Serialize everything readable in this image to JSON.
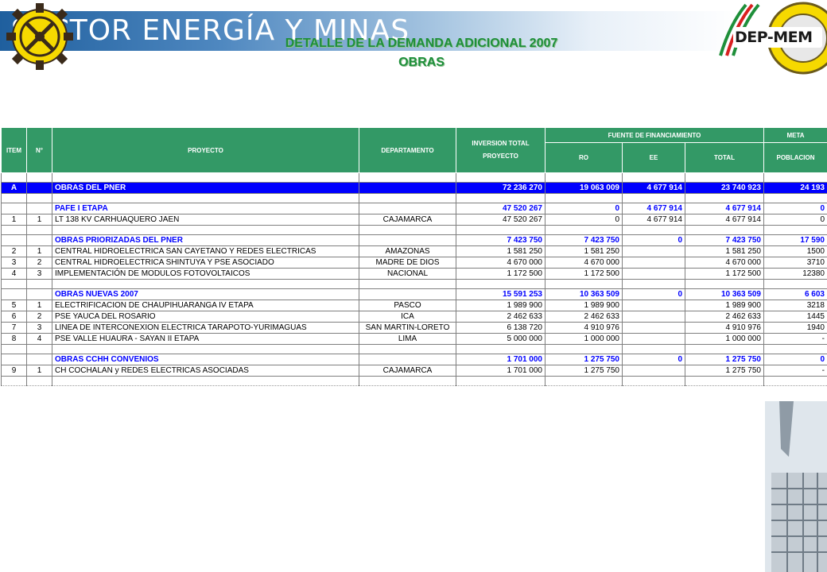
{
  "header": {
    "banner_title": "SECTOR ENERGÍA Y MINAS",
    "title_line1": "DETALLE DE LA DEMANDA ADICIONAL 2007",
    "title_line2": "OBRAS",
    "logo_text": "DEP-MEM"
  },
  "colors": {
    "header_green": "#339966",
    "total_blue": "#0000ff",
    "section_blue": "#0000ff",
    "title_green": "#1e8f3a"
  },
  "table": {
    "headers": {
      "item": "ITEM",
      "no": "N°",
      "proyecto": "PROYECTO",
      "departamento": "DEPARTAMENTO",
      "inversion_1": "INVERSION TOTAL",
      "inversion_2": "PROYECTO",
      "fuente": "FUENTE DE FINANCIAMIENTO",
      "meta": "META",
      "ro": "RO",
      "ee": "EE",
      "total": "TOTAL",
      "poblacion": "POBLACION"
    },
    "grand_total": {
      "item": "A",
      "proyecto": "OBRAS DEL PNER",
      "inversion": "72 236 270",
      "ro": "19 063 009",
      "ee": "4 677 914",
      "total": "23 740 923",
      "poblacion": "24 193"
    },
    "sections": [
      {
        "title": {
          "proyecto": "PAFE I ETAPA",
          "inversion": "47 520 267",
          "ro": "0",
          "ee": "4 677 914",
          "total": "4 677 914",
          "poblacion": "0"
        },
        "rows": [
          {
            "item": "1",
            "no": "1",
            "proyecto": "LT 138 KV CARHUAQUERO JAEN",
            "departamento": "CAJAMARCA",
            "inversion": "47 520 267",
            "ro": "0",
            "ee": "4 677 914",
            "total": "4 677 914",
            "poblacion": "0"
          }
        ]
      },
      {
        "title": {
          "proyecto": "OBRAS PRIORIZADAS DEL PNER",
          "inversion": "7 423 750",
          "ro": "7 423 750",
          "ee": "0",
          "total": "7 423 750",
          "poblacion": "17 590"
        },
        "rows": [
          {
            "item": "2",
            "no": "1",
            "proyecto": "CENTRAL HIDROELECTRICA SAN CAYETANO Y REDES ELECTRICAS",
            "departamento": "AMAZONAS",
            "inversion": "1 581 250",
            "ro": "1 581 250",
            "ee": "",
            "total": "1 581 250",
            "poblacion": "1500"
          },
          {
            "item": "3",
            "no": "2",
            "proyecto": "CENTRAL HIDROELECTRICA SHINTUYA Y PSE ASOCIADO",
            "departamento": "MADRE DE DIOS",
            "inversion": "4 670 000",
            "ro": "4 670 000",
            "ee": "",
            "total": "4 670 000",
            "poblacion": "3710"
          },
          {
            "item": "4",
            "no": "3",
            "proyecto": "IMPLEMENTACIÓN DE MODULOS FOTOVOLTAICOS",
            "departamento": "NACIONAL",
            "inversion": "1 172 500",
            "ro": "1 172 500",
            "ee": "",
            "total": "1 172 500",
            "poblacion": "12380"
          }
        ]
      },
      {
        "title": {
          "proyecto": "OBRAS NUEVAS 2007",
          "inversion": "15 591 253",
          "ro": "10 363 509",
          "ee": "0",
          "total": "10 363 509",
          "poblacion": "6 603"
        },
        "rows": [
          {
            "item": "5",
            "no": "1",
            "proyecto": "ELECTRIFICACION DE CHAUPIHUARANGA IV ETAPA",
            "departamento": "PASCO",
            "inversion": "1 989 900",
            "ro": "1 989 900",
            "ee": "",
            "total": "1 989 900",
            "poblacion": "3218"
          },
          {
            "item": "6",
            "no": "2",
            "proyecto": "PSE YAUCA DEL ROSARIO",
            "departamento": "ICA",
            "inversion": "2 462 633",
            "ro": "2 462 633",
            "ee": "",
            "total": "2 462 633",
            "poblacion": "1445"
          },
          {
            "item": "7",
            "no": "3",
            "proyecto": "LINEA DE INTERCONEXION ELECTRICA TARAPOTO-YURIMAGUAS",
            "departamento": "SAN MARTIN-LORETO",
            "inversion": "6 138 720",
            "ro": "4 910 976",
            "ee": "",
            "total": "4 910 976",
            "poblacion": "1940"
          },
          {
            "item": "8",
            "no": "4",
            "proyecto": "PSE VALLE HUAURA - SAYAN II ETAPA",
            "departamento": "LIMA",
            "inversion": "5 000 000",
            "ro": "1 000 000",
            "ee": "",
            "total": "1 000 000",
            "poblacion": "-"
          }
        ]
      },
      {
        "title": {
          "proyecto": "OBRAS CCHH CONVENIOS",
          "inversion": "1 701 000",
          "ro": "1 275 750",
          "ee": "0",
          "total": "1 275 750",
          "poblacion": "0"
        },
        "rows": [
          {
            "item": "9",
            "no": "1",
            "proyecto": "CH COCHALAN y REDES ELECTRICAS ASOCIADAS",
            "departamento": "CAJAMARCA",
            "inversion": "1 701 000",
            "ro": "1 275 750",
            "ee": "",
            "total": "1 275 750",
            "poblacion": "-"
          }
        ]
      }
    ]
  }
}
